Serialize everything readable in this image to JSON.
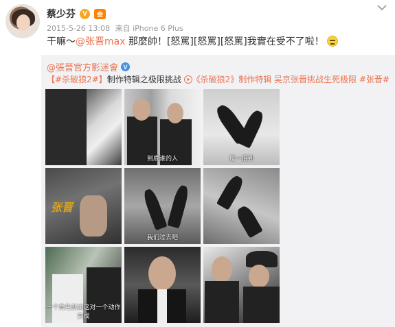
{
  "post": {
    "username": "蔡少芬",
    "vip_badge": "V",
    "member_badge": "会",
    "timestamp": "2015-5-26 13:08",
    "source": "来自 iPhone 6 Plus",
    "text_prefix": "干嘛～",
    "mention": "@张晋max",
    "text_rest": " 那麼帥！[怒罵][怒罵][怒罵]我實在受不了啦！",
    "emoji_icon": "sweat-smile-emoji"
  },
  "repost": {
    "author": "@張晉官方影迷會",
    "verified_badge": "V",
    "tag1": "【#杀破狼2#】",
    "text1": "制作特辑之极限挑战 ",
    "link_icon": "video-link-icon",
    "link_text": "《杀破狼2》制作特辑 吴京张晋挑战生死极限",
    "tag2": " #张晋#"
  },
  "images": [
    {
      "subtitle": ""
    },
    {
      "subtitle": "到底谁的人"
    },
    {
      "subtitle": "是一招到"
    },
    {
      "subtitle": "",
      "logo": "张晋"
    },
    {
      "subtitle": "我们过去吧"
    },
    {
      "subtitle": ""
    },
    {
      "subtitle": "一个角色就由这对一个动作完成"
    },
    {
      "subtitle": ""
    },
    {
      "subtitle": ""
    }
  ],
  "colors": {
    "accent": "#eb7350",
    "vip": "#f5a623",
    "verified": "#4a90e2",
    "repost_bg": "#f2f2f5"
  }
}
